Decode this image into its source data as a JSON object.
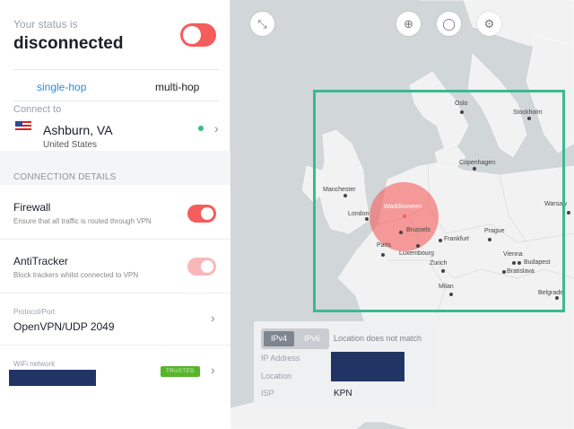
{
  "status": {
    "label": "Your status is",
    "value": "disconnected",
    "toggle_on": false
  },
  "hop": {
    "single": "single-hop",
    "multi": "multi-hop",
    "selected": "single-hop"
  },
  "connect": {
    "label": "Connect to",
    "city": "Ashburn, VA",
    "country": "United States",
    "flag": "us-flag"
  },
  "connection_details": {
    "title": "CONNECTION DETAILS",
    "firewall": {
      "title": "Firewall",
      "desc": "Ensure that all traffic is routed through VPN",
      "on": true
    },
    "antitracker": {
      "title": "AntiTracker",
      "desc": "Block trackers whilst connected to VPN",
      "on": true
    },
    "protocol": {
      "label": "Protocol/Port",
      "value": "OpenVPN/UDP 2049"
    },
    "wifi": {
      "label": "WiFi network",
      "badge": "TRUSTED"
    }
  },
  "map": {
    "cities": [
      "Oslo",
      "Stockholm",
      "Copenhagen",
      "Manchester",
      "London",
      "Waddinxveen",
      "Brussels",
      "Frankfurt",
      "Paris",
      "Luxembourg",
      "Prague",
      "Warsaw",
      "Zurich",
      "Vienna",
      "Budapest",
      "Bratislava",
      "Milan",
      "Belgrade"
    ],
    "current_location": "Waddinxveen",
    "highlight_color": "#3db88f"
  },
  "info": {
    "ipv4": "IPv4",
    "ipv6": "IPv6",
    "selected": "IPv4",
    "mismatch": "Location does not match",
    "ip_label": "IP Address",
    "location_label": "Location",
    "isp_label": "ISP",
    "isp_value": "KPN"
  },
  "colors": {
    "accent_blue": "#2d8de0",
    "toggle_red": "#f55c5c",
    "trusted_green": "#57b52c",
    "online_green": "#2fc47a"
  }
}
